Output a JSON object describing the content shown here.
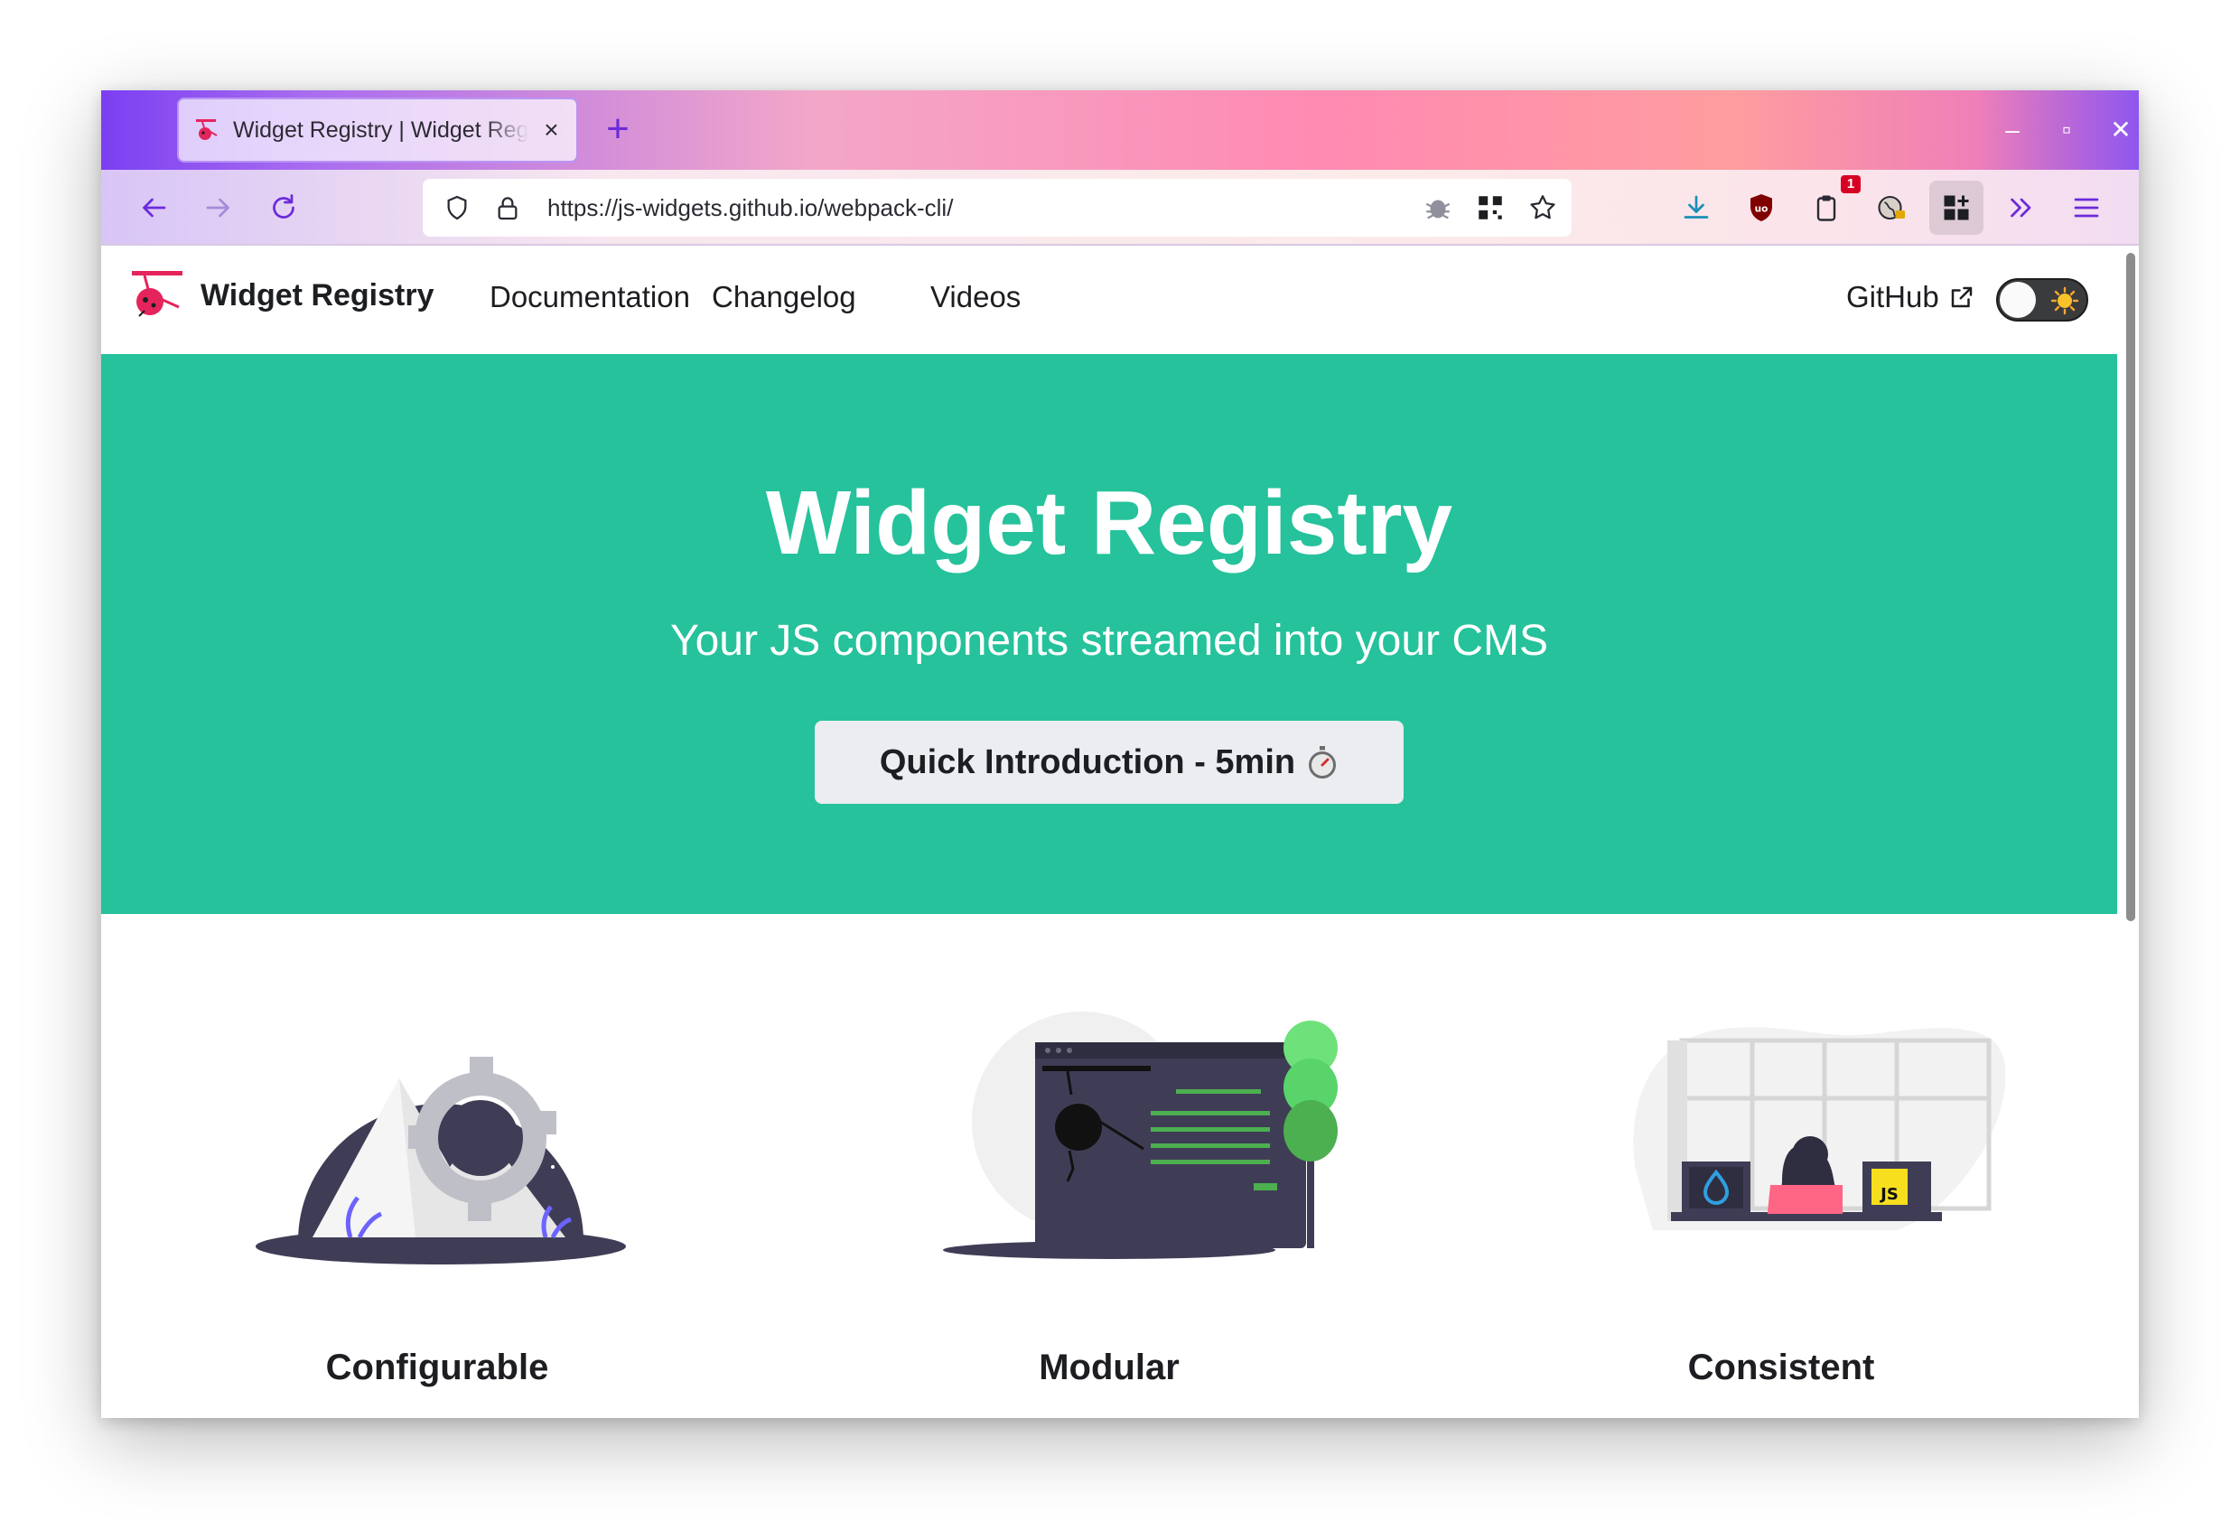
{
  "browser": {
    "tab": {
      "title": "Widget Registry | Widget Registry",
      "close": "×"
    },
    "new_tab": "+",
    "window_controls": {
      "minimize": "–",
      "maximize": "▫",
      "close": "✕"
    },
    "url": "https://js-widgets.github.io/webpack-cli/",
    "extension_badge_count": "1",
    "accent_color": "#6b2bd9"
  },
  "site": {
    "brand": "Widget Registry",
    "nav_links": [
      "Documentation",
      "Changelog",
      "Videos"
    ],
    "github": "GitHub",
    "theme_toggle": {
      "state": "light"
    }
  },
  "hero": {
    "title": "Widget Registry",
    "subtitle": "Your JS components streamed into your CMS",
    "button": "Quick Introduction - 5min",
    "background": "#25c29b"
  },
  "features": [
    {
      "title": "Configurable",
      "illustration": "mountains-gear-illustration"
    },
    {
      "title": "Modular",
      "illustration": "browser-window-tree-illustration"
    },
    {
      "title": "Consistent",
      "illustration": "person-at-desk-illustration"
    }
  ]
}
